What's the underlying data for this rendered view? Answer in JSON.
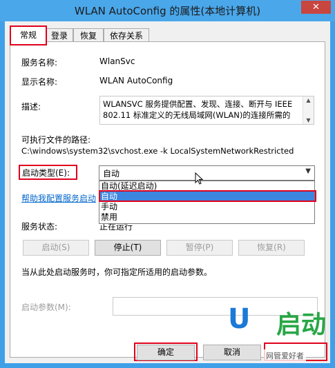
{
  "window": {
    "title": "WLAN AutoConfig 的属性(本地计算机)",
    "close": "✕"
  },
  "tabs": [
    {
      "label": "常规",
      "active": true
    },
    {
      "label": "登录"
    },
    {
      "label": "恢复"
    },
    {
      "label": "依存关系"
    }
  ],
  "general": {
    "service_name_label": "服务名称:",
    "service_name": "WlanSvc",
    "display_name_label": "显示名称:",
    "display_name": "WLAN AutoConfig",
    "description_label": "描述:",
    "description": "WLANSVC 服务提供配置、发现、连接、断开与 IEEE 802.11 标准定义的无线局域网(WLAN)的连接所需的",
    "exe_path_label": "可执行文件的路径:",
    "exe_path": "C:\\windows\\system32\\svchost.exe -k LocalSystemNetworkRestricted",
    "startup_type_label": "启动类型(E):",
    "startup_type_value": "自动",
    "startup_options": [
      "自动(延迟启动)",
      "自动",
      "手动",
      "禁用"
    ],
    "help_link": "帮助我配置服务启动",
    "status_label": "服务状态:",
    "status_value": "正在运行",
    "buttons": {
      "start": "启动(S)",
      "stop": "停止(T)",
      "pause": "暂停(P)",
      "resume": "恢复(R)"
    },
    "hint": "当从此处启动服务时，你可指定所适用的启动参数。",
    "start_params_label": "启动参数(M):",
    "start_params_value": ""
  },
  "footer": {
    "ok": "确定",
    "cancel": "取消"
  },
  "watermark": {
    "logo_u": "U",
    "logo_text": "启动",
    "caption": "网管爱好者"
  },
  "colors": {
    "accent": "#e0001b",
    "selection": "#3d86e0",
    "titlebar": "#4aa7ea",
    "close": "#c7463f"
  }
}
